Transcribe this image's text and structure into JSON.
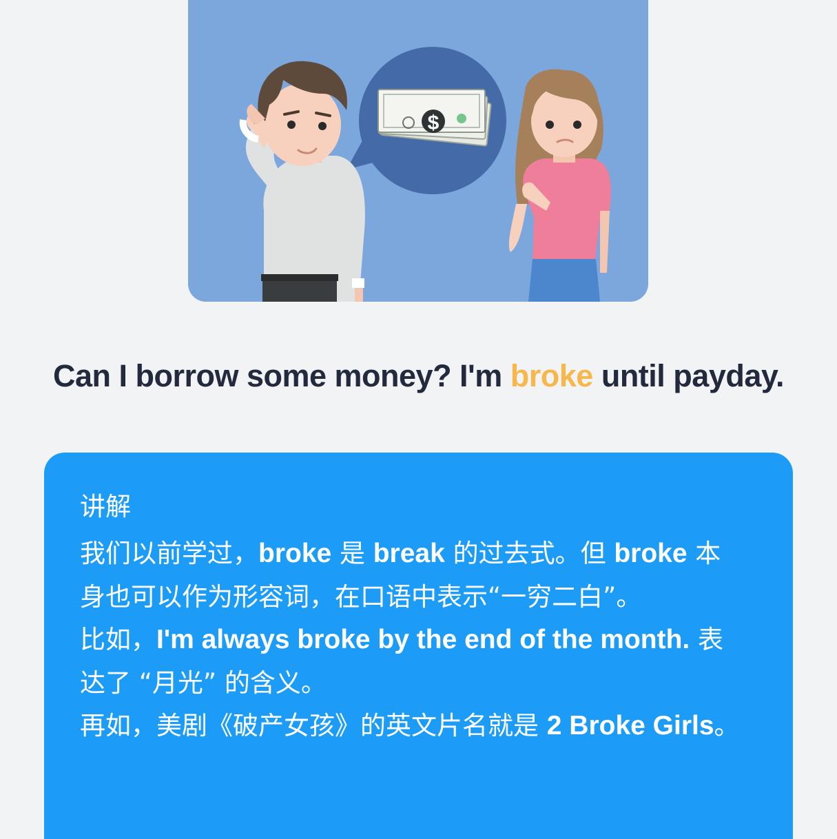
{
  "illustration": {
    "bill_symbol": "$"
  },
  "sentence": {
    "before": "Can I borrow some money? I'm ",
    "highlight": "broke",
    "after": " until payday."
  },
  "colors": {
    "highlight": "#f8b74c",
    "card": "#1c9cf6",
    "illustration_bg": "#7ba7dc"
  },
  "explanation": {
    "title": "讲解",
    "p1": {
      "t1": "我们以前学过，",
      "b1": "broke",
      "t2": " 是 ",
      "b2": "break",
      "t3": " 的过去式。但 ",
      "b3": "broke",
      "t4": " 本身也可以作为形容词，在口语中表示“一穷二白”。"
    },
    "p2": {
      "t1": "比如，",
      "b1": "I'm always broke by the end of the month.",
      "t2": " 表达了 “月光” 的含义。"
    },
    "p3": {
      "t1": "再如，美剧《破产女孩》的英文片名就是 ",
      "b1": "2 Broke Girls",
      "t2": "。"
    }
  }
}
